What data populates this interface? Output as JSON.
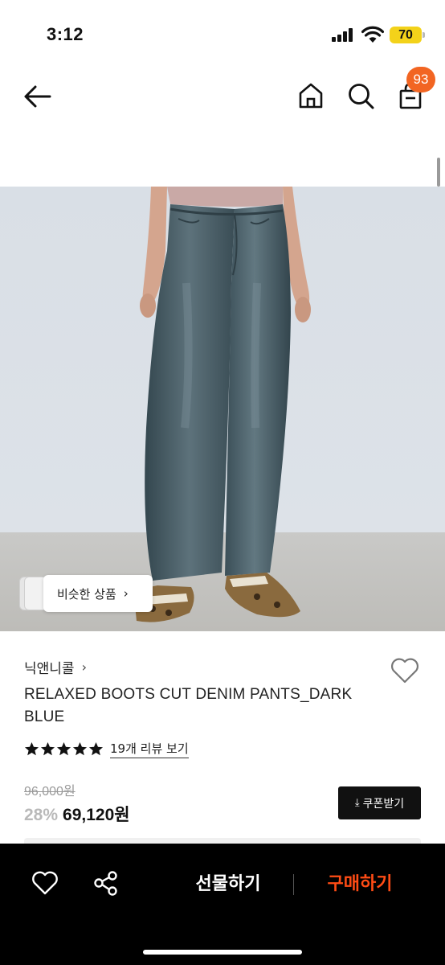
{
  "status_bar": {
    "time": "3:12",
    "battery": "70",
    "icons": [
      "signal-icon",
      "wifi-icon",
      "battery-icon"
    ]
  },
  "nav": {
    "icons": [
      "arrow-left-icon",
      "home-icon",
      "search-icon",
      "shopping-bag-icon"
    ],
    "cart_count": "93"
  },
  "product": {
    "similar_button_label": "비슷한 상품",
    "brand": "닉앤니콜",
    "name": "RELAXED BOOTS CUT DENIM PANTS_DARK BLUE",
    "rating_stars": 5,
    "review_link": "19개 리뷰 보기",
    "original_price": "96,000원",
    "discount": "28%",
    "sale_price": "69,120원",
    "coupon_button": "쿠폰받기"
  },
  "bottom_bar": {
    "gift_label": "선물하기",
    "buy_label": "구매하기",
    "icons": [
      "heart-icon",
      "share-icon"
    ]
  },
  "colors": {
    "accent_orange": "#ff4c15",
    "badge_orange": "#f26522",
    "battery_yellow": "#f3d21a",
    "denim": "#3f5561"
  }
}
